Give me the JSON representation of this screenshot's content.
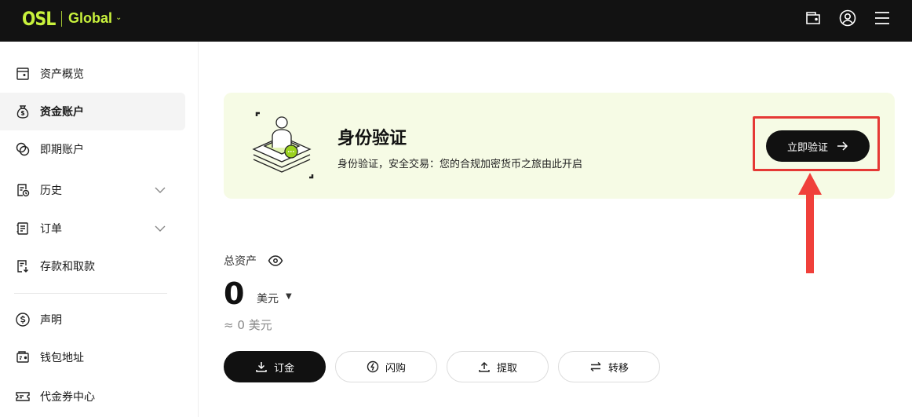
{
  "header": {
    "logo_text": "OSL",
    "region": "Global",
    "icons": [
      "wallet-icon",
      "user-icon",
      "menu-icon"
    ]
  },
  "sidebar": {
    "items": [
      {
        "label": "资产概览",
        "icon": "document-icon"
      },
      {
        "label": "资金账户",
        "icon": "money-bag-icon",
        "active": true
      },
      {
        "label": "即期账户",
        "icon": "exchange-icon"
      },
      {
        "label": "历史",
        "icon": "history-icon",
        "expandable": true
      },
      {
        "label": "订单",
        "icon": "orders-icon",
        "expandable": true
      },
      {
        "label": "存款和取款",
        "icon": "deposit-withdraw-icon"
      },
      {
        "label": "声明",
        "icon": "dollar-icon"
      },
      {
        "label": "钱包地址",
        "icon": "wallet-address-icon"
      },
      {
        "label": "代金券中心",
        "icon": "voucher-icon"
      }
    ]
  },
  "banner": {
    "title": "身份验证",
    "subtitle": "身份验证，安全交易：您的合规加密货币之旅由此开启",
    "button_label": "立即验证"
  },
  "assets": {
    "label": "总资产",
    "value": "0",
    "currency": "美元",
    "approx": "≈ 0 美元"
  },
  "actions": [
    {
      "label": "订金",
      "icon": "download-icon"
    },
    {
      "label": "闪购",
      "icon": "flash-icon"
    },
    {
      "label": "提取",
      "icon": "upload-icon"
    },
    {
      "label": "转移",
      "icon": "transfer-icon"
    }
  ],
  "colors": {
    "brand": "#c8f13c",
    "topbar": "#121212",
    "banner_bg": "#f6fbe5",
    "highlight": "#e53935"
  }
}
